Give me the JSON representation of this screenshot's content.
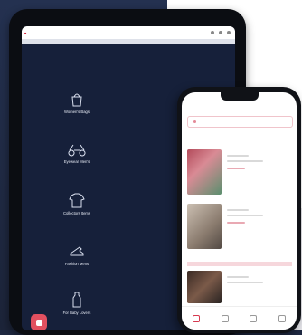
{
  "tablet": {
    "categories": [
      {
        "label": "Women's Bags",
        "icon": "bag-icon"
      },
      {
        "label": "",
        "icon": "dress-icon"
      },
      {
        "label": "Eyewear Men's",
        "icon": "glasses-icon"
      },
      {
        "label": "",
        "icon": "glasses-icon"
      },
      {
        "label": "Collectors Items",
        "icon": "shirt-icon"
      },
      {
        "label": "",
        "icon": "tag-icon"
      },
      {
        "label": "Fashion Mens",
        "icon": "shoe-icon"
      },
      {
        "label": "",
        "icon": "tag-icon"
      },
      {
        "label": "For Baby Lovers",
        "icon": "bottle-icon"
      },
      {
        "label": "",
        "icon": "tag-icon"
      }
    ]
  },
  "colors": {
    "brand": "#d2263d",
    "tablet_bg": "#16203a",
    "right_bg": "#ffffff"
  }
}
